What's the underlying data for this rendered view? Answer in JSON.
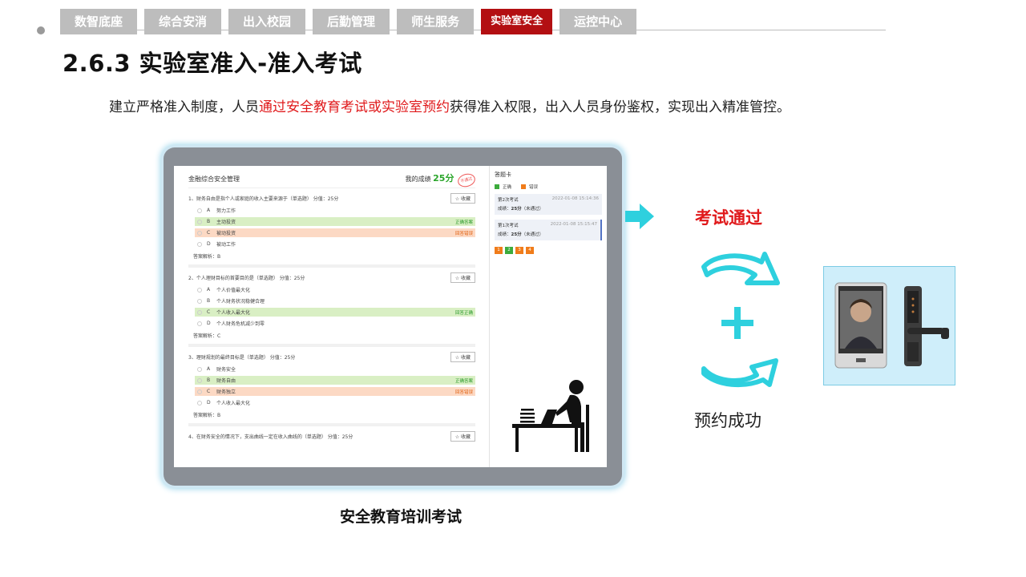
{
  "nav": {
    "tabs": [
      "数智底座",
      "综合安消",
      "出入校园",
      "后勤管理",
      "师生服务",
      "实验室安全",
      "运控中心"
    ],
    "active_index": 5
  },
  "page": {
    "title": "2.6.3 实验室准入-准入考试",
    "desc_before": "建立严格准入制度，人员",
    "desc_highlight": "通过安全教育考试或实验室预约",
    "desc_after": "获得准入权限，出入人员身份鉴权，实现出入精准管控。",
    "caption": "安全教育培训考试",
    "pass_label": "考试通过",
    "booking_label": "预约成功"
  },
  "exam": {
    "title": "金融综合安全管理",
    "score_label": "我的成绩",
    "score": "25分",
    "stamp": "不通过",
    "questions": [
      {
        "text": "1、财务自由是指个人或家庭的收入主要来源于（单选题） 分值：25分",
        "fav": "☆ 收藏",
        "options": [
          {
            "letter": "A",
            "text": "努力工作",
            "tag": "",
            "state": ""
          },
          {
            "letter": "B",
            "text": "主动投资",
            "tag": "正确答案",
            "state": "ok"
          },
          {
            "letter": "C",
            "text": "被动投资",
            "tag": "回答错误",
            "state": "bad"
          },
          {
            "letter": "D",
            "text": "被动工作",
            "tag": "",
            "state": ""
          }
        ],
        "analysis": "答案解析：B"
      },
      {
        "text": "2、个人理财目标的首要目的是（单选题） 分值：25分",
        "fav": "☆ 收藏",
        "options": [
          {
            "letter": "A",
            "text": "个人价值最大化",
            "tag": "",
            "state": ""
          },
          {
            "letter": "B",
            "text": "个人财务状况稳健合理",
            "tag": "",
            "state": ""
          },
          {
            "letter": "C",
            "text": "个人收入最大化",
            "tag": "回答正确",
            "state": "ok"
          },
          {
            "letter": "D",
            "text": "个人财务危机减少到零",
            "tag": "",
            "state": ""
          }
        ],
        "analysis": "答案解析：C"
      },
      {
        "text": "3、理财规划的最终目标是（单选题） 分值：25分",
        "fav": "☆ 收藏",
        "options": [
          {
            "letter": "A",
            "text": "财务安全",
            "tag": "",
            "state": ""
          },
          {
            "letter": "B",
            "text": "财务自由",
            "tag": "正确答案",
            "state": "ok"
          },
          {
            "letter": "C",
            "text": "财务独立",
            "tag": "回答错误",
            "state": "bad"
          },
          {
            "letter": "D",
            "text": "个人收入最大化",
            "tag": "",
            "state": ""
          }
        ],
        "analysis": "答案解析：B"
      },
      {
        "text": "4、在财务安全的情况下，支出曲线一定在收入曲线的（单选题） 分值：25分",
        "fav": "☆ 收藏",
        "options": [],
        "analysis": ""
      }
    ]
  },
  "answer_card": {
    "title": "答题卡",
    "legend_correct": "正确",
    "legend_wrong": "错误",
    "attempts": [
      {
        "name": "第2次考试",
        "date": "2022-01-08 15:14:36",
        "result_label": "成绩：",
        "score": "25分",
        "status": "（未通过）"
      },
      {
        "name": "第1次考试",
        "date": "2022-01-08 15:15:47",
        "result_label": "成绩：",
        "score": "25分",
        "status": "（未通过）"
      }
    ],
    "numbers": [
      {
        "n": "1",
        "state": "o"
      },
      {
        "n": "2",
        "state": "g"
      },
      {
        "n": "3",
        "state": "o"
      },
      {
        "n": "4",
        "state": "o"
      }
    ]
  },
  "colors": {
    "accent_red": "#b30f12",
    "highlight_red": "#e0191b",
    "arrow_cyan": "#2ed0de",
    "tab_gray": "#bdbdbd"
  }
}
